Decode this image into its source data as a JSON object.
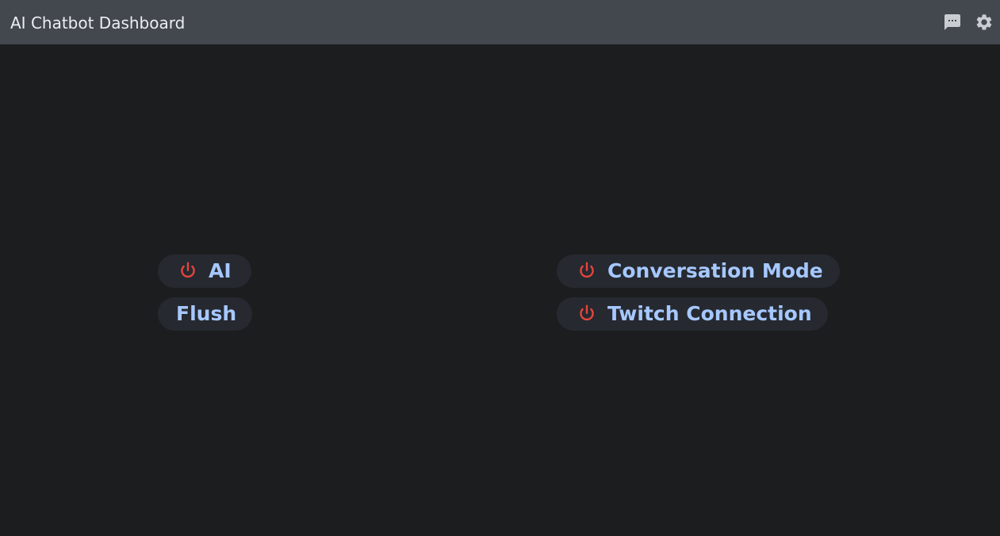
{
  "header": {
    "title": "AI Chatbot Dashboard",
    "icons": [
      "chat-icon",
      "gear-icon"
    ]
  },
  "controls": {
    "ai": {
      "label": "AI",
      "icon": "power-icon",
      "state": "off"
    },
    "flush": {
      "label": "Flush"
    },
    "conversation_mode": {
      "label": "Conversation Mode",
      "icon": "power-icon",
      "state": "off"
    },
    "twitch_connection": {
      "label": "Twitch Connection",
      "icon": "power-icon",
      "state": "off"
    }
  },
  "colors": {
    "background": "#1c1d1f",
    "topbar": "#43474e",
    "pill": "#262930",
    "label": "#a6c8ff",
    "power_off": "#e5453d"
  }
}
